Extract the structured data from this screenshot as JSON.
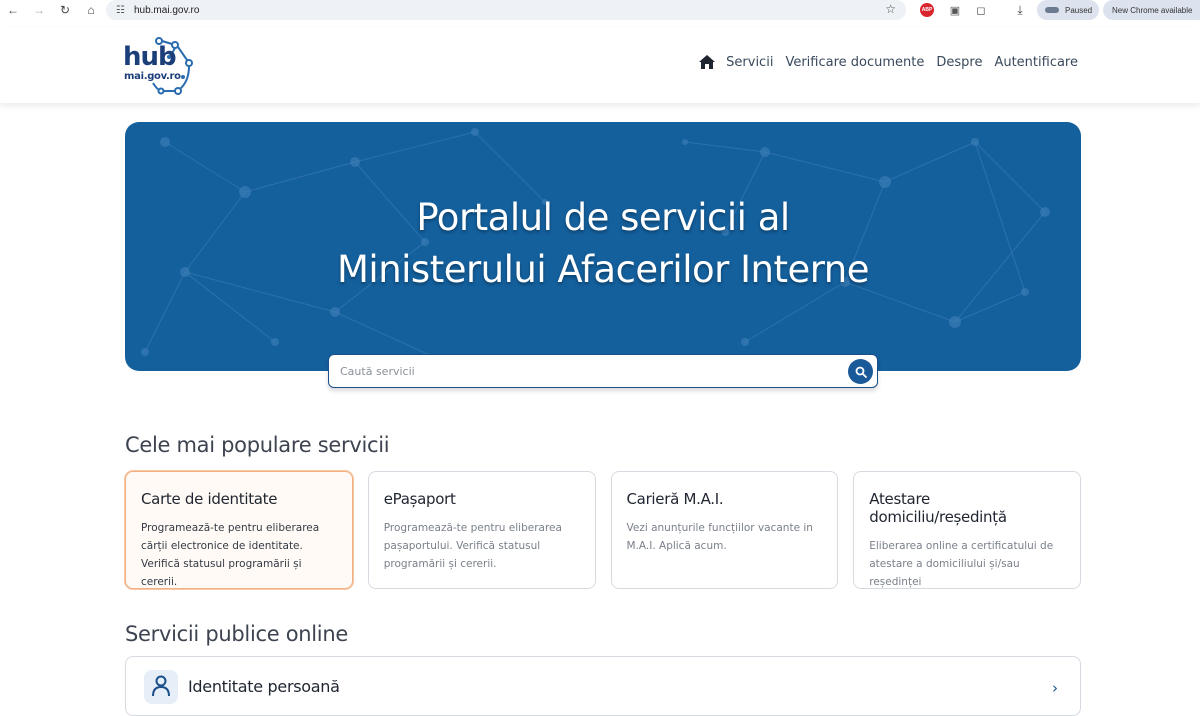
{
  "browser": {
    "url": "hub.mai.gov.ro",
    "profile_status": "Paused",
    "update_label": "New Chrome available",
    "abp_badge": "ABP"
  },
  "header": {
    "logo_main": "hub",
    "logo_sub": "mai.gov.ro",
    "nav": [
      "Servicii",
      "Verificare documente",
      "Despre",
      "Autentificare"
    ]
  },
  "hero": {
    "title_line1": "Portalul de servicii al",
    "title_line2": "Ministerului Afacerilor Interne"
  },
  "search": {
    "placeholder": "Caută servicii"
  },
  "popular": {
    "title": "Cele mai populare servicii",
    "cards": [
      {
        "title": "Carte de identitate",
        "desc": "Programează-te pentru eliberarea cărții electronice de identitate. Verifică statusul programării și cererii."
      },
      {
        "title": "ePașaport",
        "desc": "Programează-te pentru eliberarea pașaportului. Verifică statusul programării și cererii."
      },
      {
        "title": "Carieră M.A.I.",
        "desc": "Vezi anunțurile funcțiilor vacante in M.A.I. Aplică acum."
      },
      {
        "title": "Atestare domiciliu/reședință",
        "desc": "Eliberarea online a certificatului de atestare a domiciliului și/sau reședinței"
      }
    ]
  },
  "online": {
    "title": "Servicii publice online",
    "items": [
      {
        "label": "Identitate persoană"
      }
    ]
  },
  "colors": {
    "brand_dark": "#1c3f7a",
    "hero_blue": "#14609d",
    "active_card_border": "#f3b183"
  }
}
